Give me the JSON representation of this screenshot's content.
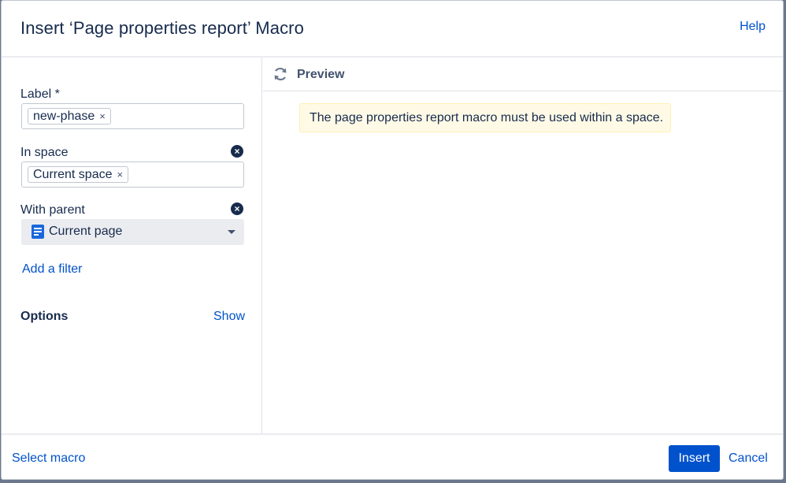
{
  "dialog": {
    "title": "Insert ‘Page properties report’ Macro",
    "help_label": "Help"
  },
  "form": {
    "label_field": {
      "label": "Label *",
      "tags": [
        "new-phase"
      ]
    },
    "space_field": {
      "label": "In space",
      "tags": [
        "Current space"
      ]
    },
    "parent_field": {
      "label": "With parent",
      "value": "Current page"
    },
    "add_filter_label": "Add a filter",
    "options_label": "Options",
    "show_label": "Show"
  },
  "preview": {
    "title": "Preview",
    "warning": "The page properties report macro must be used within a space."
  },
  "footer": {
    "select_macro_label": "Select macro",
    "insert_label": "Insert",
    "cancel_label": "Cancel"
  },
  "icons": {
    "tag_remove": "×",
    "clear": "×"
  },
  "colors": {
    "link": "#0052cc",
    "primary_button": "#0052cc",
    "warning_bg": "#fffae6",
    "page_icon": "#1868db"
  }
}
